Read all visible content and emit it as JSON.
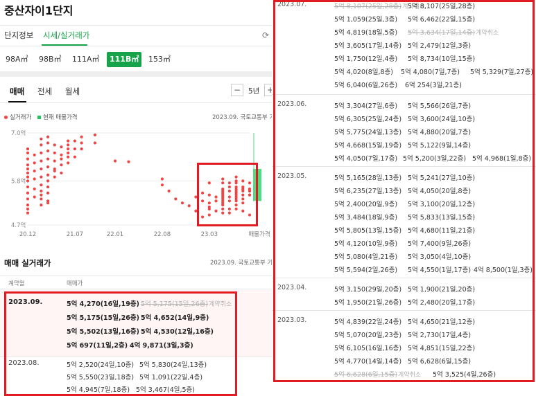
{
  "header": {
    "title": "중산자이1단지"
  },
  "main_tabs": [
    {
      "label": "단지정보",
      "active": false
    },
    {
      "label": "시세/실거래가",
      "active": true
    }
  ],
  "icons": {
    "refresh": "refresh-icon"
  },
  "sizes": [
    {
      "label": "98A㎡",
      "active": false
    },
    {
      "label": "98B㎡",
      "active": false
    },
    {
      "label": "111A㎡",
      "active": false
    },
    {
      "label": "111B㎡",
      "active": true
    },
    {
      "label": "153㎡",
      "active": false
    }
  ],
  "deal_tabs": [
    {
      "label": "매매",
      "active": true
    },
    {
      "label": "전세",
      "active": false
    },
    {
      "label": "월세",
      "active": false
    }
  ],
  "period": {
    "minus": "−",
    "label": "5년",
    "plus": "+"
  },
  "legend": {
    "actual": "실거래가",
    "current": "현재 매물가격"
  },
  "chart_source": "2023.09. 국토교통부 기",
  "colors": {
    "accent": "#16a34a",
    "dot": "#ef4444",
    "listing": "#4ade80",
    "highlight_box": "#e01b24"
  },
  "chart_data": {
    "type": "scatter",
    "y_ticks": [
      "7.0억",
      "5.8억",
      "4.7억"
    ],
    "ylim": [
      4.7,
      7.0
    ],
    "x_ticks": [
      "20.12",
      "21.07",
      "22.01",
      "22.08",
      "23.03",
      "매물가격"
    ],
    "listing_range": {
      "label": "매물가격",
      "low": 5.3,
      "high": 6.1
    },
    "series": [
      {
        "x": [
          "2020-12",
          "2020-12",
          "2020-12",
          "2020-12",
          "2020-12",
          "2020-12",
          "2020-12",
          "2020-12",
          "2020-12",
          "2020-12",
          "2020-12",
          "2020-12",
          "2020-12",
          "2020-12",
          "2021-01",
          "2021-01",
          "2021-01",
          "2021-01",
          "2021-01",
          "2021-01",
          "2021-02",
          "2021-02",
          "2021-02",
          "2021-02",
          "2021-02",
          "2021-02",
          "2021-02",
          "2021-02",
          "2021-02",
          "2021-02",
          "2021-02",
          "2021-03",
          "2021-03",
          "2021-03",
          "2021-03",
          "2021-03",
          "2021-03",
          "2021-03",
          "2021-03",
          "2021-03",
          "2021-03",
          "2021-03",
          "2021-04",
          "2021-04",
          "2021-04",
          "2021-04",
          "2021-04",
          "2021-04",
          "2021-05",
          "2021-05",
          "2021-05",
          "2021-05",
          "2021-05",
          "2021-06",
          "2021-06",
          "2021-06",
          "2021-06",
          "2021-06",
          "2021-06",
          "2021-07",
          "2021-07",
          "2021-07",
          "2021-08",
          "2021-08",
          "2021-08",
          "2021-10",
          "2021-10",
          "2022-01",
          "2022-03",
          "2022-08",
          "2022-08",
          "2022-09",
          "2022-10",
          "2022-11",
          "2022-12",
          "2023-01",
          "2023-01",
          "2023-02",
          "2023-02",
          "2023-02",
          "2023-03",
          "2023-03",
          "2023-03",
          "2023-03",
          "2023-03",
          "2023-03",
          "2023-04",
          "2023-04",
          "2023-04",
          "2023-05",
          "2023-05",
          "2023-05",
          "2023-05",
          "2023-05",
          "2023-05",
          "2023-05",
          "2023-05",
          "2023-05",
          "2023-05",
          "2023-05",
          "2023-05",
          "2023-05",
          "2023-06",
          "2023-06",
          "2023-06",
          "2023-06",
          "2023-06",
          "2023-06",
          "2023-06",
          "2023-07",
          "2023-07",
          "2023-07",
          "2023-07",
          "2023-07",
          "2023-07",
          "2023-07",
          "2023-07",
          "2023-07",
          "2023-07",
          "2023-07",
          "2023-07",
          "2023-07",
          "2023-08",
          "2023-08",
          "2023-08",
          "2023-08",
          "2023-08",
          "2023-08",
          "2023-08",
          "2023-08",
          "2023-09",
          "2023-09",
          "2023-09",
          "2023-09",
          "2023-09",
          "2023-09",
          "2023-09",
          "2023-09",
          "2023-09"
        ],
        "y": [
          5.0,
          5.2,
          5.35,
          5.5,
          5.65,
          5.8,
          5.9,
          6.0,
          6.1,
          6.2,
          6.35,
          6.5,
          6.6,
          5.1,
          5.4,
          5.6,
          5.85,
          6.05,
          6.25,
          6.45,
          5.2,
          5.35,
          5.55,
          5.7,
          5.9,
          6.1,
          6.3,
          6.5,
          6.7,
          6.85,
          5.45,
          5.3,
          5.5,
          5.65,
          5.8,
          5.95,
          6.15,
          6.35,
          6.55,
          6.75,
          6.9,
          5.25,
          5.9,
          6.1,
          6.3,
          6.5,
          6.7,
          6.05,
          6.0,
          6.2,
          6.45,
          6.65,
          6.35,
          6.4,
          6.6,
          6.8,
          6.25,
          6.5,
          6.7,
          6.4,
          6.6,
          6.8,
          6.6,
          6.75,
          6.9,
          6.75,
          6.95,
          6.3,
          6.28,
          5.85,
          5.7,
          5.55,
          5.35,
          5.25,
          5.18,
          5.4,
          5.05,
          5.3,
          5.5,
          4.9,
          5.45,
          5.1,
          5.25,
          5.75,
          4.95,
          5.15,
          5.4,
          5.05,
          5.3,
          5.6,
          5.3,
          5.4,
          5.5,
          5.1,
          5.75,
          5.2,
          5.45,
          5.35,
          5.55,
          5.0,
          5.25,
          5.85,
          5.65,
          5.4,
          5.3,
          5.55,
          5.1,
          5.75,
          5.0,
          5.9,
          5.6,
          5.4,
          5.75,
          5.5,
          5.2,
          5.8,
          5.45,
          5.35,
          5.65,
          5.55,
          5.3,
          5.1,
          5.25,
          5.55,
          5.45,
          5.6,
          5.35,
          5.8,
          5.05,
          5.65,
          5.45,
          5.6,
          5.55,
          5.45,
          5.75,
          5.55,
          5.55,
          4.95,
          5.6
        ]
      }
    ]
  },
  "list": {
    "title": "매매 실거래가",
    "source": "2023.09. 국토교통부 기",
    "col_date": "계약월",
    "col_price": "매매가",
    "cancel_label": "계약취소",
    "months": [
      {
        "month": "2023.09.",
        "rows": [
          [
            "5억 4,270(16일,19층)",
            "5억 5,175(15일,26층)"
          ],
          [
            "5억 5,175(15일,26층)",
            "5억 4,652(14일,9층)"
          ],
          [
            "5억 5,502(13일,16층)",
            "5억 4,530(12일,16층)"
          ],
          [
            "5억 697(11일,2층)",
            "4억 9,871(3일,3층)"
          ]
        ]
      },
      {
        "month": "2023.08.",
        "rows": [
          [
            "5억 2,520(24일,10층)",
            "5억 5,830(24일,13층)"
          ],
          [
            "5억 5,550(23일,18층)",
            "5억 1,091(22일,4층)"
          ],
          [
            "5억 4,945(7일,18층)",
            "5억 3,467(4일,5층)"
          ]
        ]
      }
    ]
  },
  "right_list": [
    {
      "month": "2023.07.",
      "rows": [
        [
          "5억 8,107(25일,28층)",
          "5억 8,107(25일,28층)"
        ],
        [
          "5억 1,059(25일,3층)",
          "5억 6,462(22일,15층)"
        ],
        [
          "5억 4,819(18일,5층)",
          "5억 3,634(17일,14층)"
        ],
        [
          "5억 3,605(17일,14층)",
          "5억 2,479(12일,3층)"
        ],
        [
          "5억 1,750(12일,4층)",
          "5억 8,734(10일,15층)"
        ],
        [
          "5억 4,020(8일,8층)",
          "5억 4,080(7일,7층)",
          "5억 5,329(7일,27층)"
        ],
        [
          "5억 6,040(6일,26층)",
          "6억 254(3일,21층)"
        ]
      ]
    },
    {
      "month": "2023.06.",
      "rows": [
        [
          "5억 3,304(27일,6층)",
          "5억 5,566(26일,7층)"
        ],
        [
          "5억 6,305(25일,24층)",
          "5억 3,600(24일,10층)"
        ],
        [
          "5억 5,775(24일,13층)",
          "5억 4,880(20일,7층)"
        ],
        [
          "5억 4,668(15일,19층)",
          "5억 5,122(9일,14층)"
        ],
        [
          "5억 4,050(7일,17층)",
          "5억 5,200(3일,22층)",
          "5억 4,968(1일,8층)"
        ]
      ]
    },
    {
      "month": "2023.05.",
      "rows": [
        [
          "5억 5,165(28일,13층)",
          "5억 5,241(27일,10층)"
        ],
        [
          "5억 6,235(27일,13층)",
          "5억 4,050(20일,8층)"
        ],
        [
          "5억 2,400(20일,9층)",
          "5억 3,100(20일,12층)"
        ],
        [
          "5억 3,484(18일,9층)",
          "5억 5,833(13일,15층)"
        ],
        [
          "5억 5,805(13일,15층)",
          "5억 4,680(11일,21층)"
        ],
        [
          "5억 4,120(10일,9층)",
          "5억 7,400(9일,26층)"
        ],
        [
          "5억 5,080(4일,21층)",
          "5억 3,050(4일,10층)"
        ],
        [
          "5억 5,594(2일,26층)",
          "5억 4,550(1일,17층)",
          "4억 8,500(1일,3층)"
        ]
      ]
    },
    {
      "month": "2023.04.",
      "rows": [
        [
          "5억 3,150(29일,20층)",
          "5억 1,900(21일,20층)"
        ],
        [
          "5억 1,950(21일,26층)",
          "5억 2,480(20일,17층)"
        ]
      ]
    },
    {
      "month": "2023.03.",
      "rows": [
        [
          "5억 4,839(22일,24층)",
          "5억 4,650(21일,12층)"
        ],
        [
          "5억 5,070(20일,23층)",
          "5억 2,730(17일,4층)"
        ],
        [
          "5억 6,105(16일,16층)",
          "5억 4,851(15일,22층)"
        ],
        [
          "5억 4,770(14일,14층)",
          "5억 6,628(6일,15층)"
        ],
        [
          "5억 6,628(6일,15층)",
          "5억 3,525(4일,26층)"
        ]
      ]
    }
  ]
}
